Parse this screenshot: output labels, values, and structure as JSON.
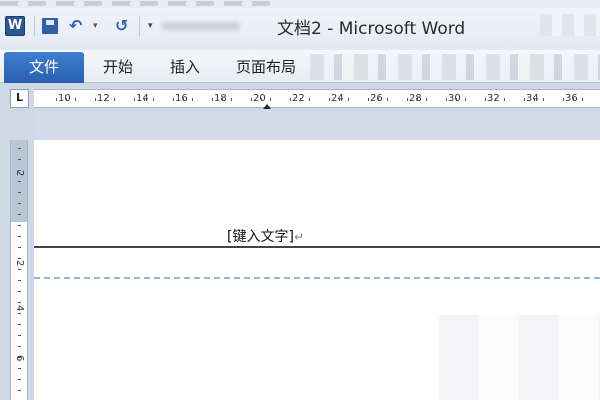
{
  "window": {
    "app_icon": "W",
    "title": "文档2 - Microsoft Word"
  },
  "quick_access": {
    "icons": [
      "save-icon",
      "undo-icon",
      "dropdown-caret-icon",
      "redo-icon",
      "customize-icon"
    ],
    "undo_glyph": "↶",
    "caret_glyph": "▾",
    "redo_glyph": "↺",
    "customize_glyph": "▾"
  },
  "ribbon": {
    "tabs": [
      {
        "label": "文件",
        "active": true
      },
      {
        "label": "开始"
      },
      {
        "label": "插入"
      },
      {
        "label": "页面布局"
      }
    ],
    "active_color": "#2b66bd"
  },
  "ruler": {
    "corner": "L",
    "labels": [
      "10",
      "12",
      "14",
      "16",
      "18",
      "20",
      "22",
      "24",
      "26",
      "28",
      "30",
      "32",
      "34",
      "36"
    ],
    "vertical_labels": [
      "2",
      "2",
      "4",
      "6"
    ]
  },
  "document": {
    "header_placeholder": "[键入文字]",
    "paragraph_mark": "↵",
    "header_line_color": "#444444",
    "header_boundary_color": "#8fb3d9"
  }
}
